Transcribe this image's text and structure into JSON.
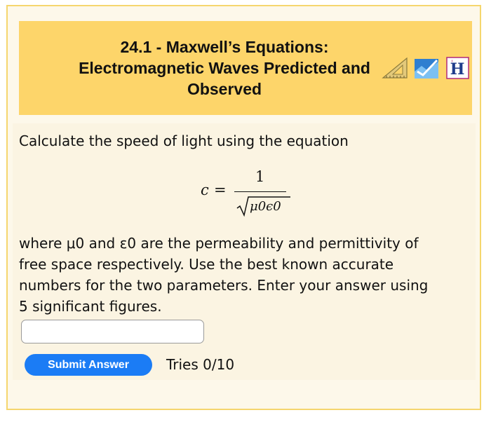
{
  "header": {
    "title_lines": [
      "24.1 - Maxwell’s Equations:",
      "Electromagnetic Waves Predicted and",
      "Observed"
    ],
    "icons": [
      "triangle-ruler-icon",
      "graph-check-icon",
      "hint-h-icon"
    ]
  },
  "problem": {
    "intro": "Calculate the speed of light using the equation",
    "formula": {
      "lhs": "c",
      "equals": "=",
      "numerator": "1",
      "denominator": "μ0ϵ0"
    },
    "paragraph_lines": [
      "where μ0 and ε0 are the permeability and permittivity of",
      "free space respectively. Use the best known accurate",
      "numbers for the two parameters. Enter your answer using",
      "5 significant figures."
    ]
  },
  "answer": {
    "value": "",
    "placeholder": ""
  },
  "actions": {
    "submit_label": "Submit Answer",
    "tries": "Tries 0/10"
  },
  "colors": {
    "frame_border": "#f5d66e",
    "header_bg": "#fdd56a",
    "content_bg": "#fbf4e2",
    "submit_bg": "#1b7cf5"
  }
}
